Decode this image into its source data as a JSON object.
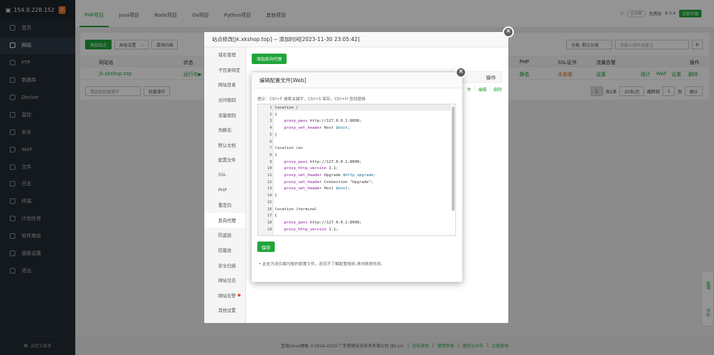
{
  "sidebar": {
    "host": "154.9.228.152",
    "badge": "0",
    "items": [
      {
        "label": "首页",
        "icon": "home-icon"
      },
      {
        "label": "网站",
        "icon": "globe-icon"
      },
      {
        "label": "FTP",
        "icon": "ftp-icon"
      },
      {
        "label": "数据库",
        "icon": "database-icon"
      },
      {
        "label": "Docker",
        "icon": "docker-icon"
      },
      {
        "label": "监控",
        "icon": "monitor-icon"
      },
      {
        "label": "安全",
        "icon": "shield-icon"
      },
      {
        "label": "WAF",
        "icon": "waf-icon"
      },
      {
        "label": "文件",
        "icon": "folder-icon"
      },
      {
        "label": "日志",
        "icon": "log-icon"
      },
      {
        "label": "终端",
        "icon": "terminal-icon"
      },
      {
        "label": "计划任务",
        "icon": "clock-icon"
      },
      {
        "label": "软件商店",
        "icon": "store-icon"
      },
      {
        "label": "面板设置",
        "icon": "gear-icon"
      },
      {
        "label": "退出",
        "icon": "logout-icon"
      }
    ],
    "bottom": "自定义菜单"
  },
  "topbar": {
    "tabs": [
      "PHP项目",
      "Java项目",
      "Node项目",
      "Go项目",
      "Python项目",
      "其他项目"
    ],
    "edition_pill": "企业版",
    "edition": "免费版",
    "version": "8.0.4",
    "upgrade": "立即升级"
  },
  "toolbar": {
    "add_site": "添加站点",
    "advanced": "高级设置",
    "scan": "漏洞扫描",
    "category": "分类: 默认分类",
    "search_placeholder": "请输入域名或备注"
  },
  "table": {
    "headers": [
      "网站名",
      "状态",
      "PHP",
      "SSL证书",
      "流量告警",
      "操作"
    ],
    "row": {
      "name": "jk.xkshop.top",
      "status": "运行中▶",
      "php": "静态",
      "ssl": "未部署",
      "alert": "设置",
      "actions": [
        "统计",
        "WAF",
        "设置",
        "删除"
      ]
    },
    "batch": "请选择批量操作",
    "batch_btn": "批量操作",
    "pagination": {
      "page": "1",
      "total": "共1条",
      "per_page": "20条/页",
      "goto": "跳转到",
      "goto_page": "1",
      "page_unit": "页",
      "confirm": "确认"
    }
  },
  "outer_modal": {
    "title": "站点修改[jk.xkshop.top] -- 添加时间[2023-11-30 23:05:42]",
    "nav": [
      "域名管理",
      "子目录绑定",
      "网站目录",
      "访问限制",
      "流量限制",
      "伪静态",
      "默认文档",
      "配置文件",
      "SSL",
      "PHP",
      "重定向",
      "反向代理",
      "防盗链",
      "防篡改",
      "安全扫描",
      "网站日志",
      "网站告警",
      "其他设置"
    ],
    "active_nav": "反向代理",
    "add_proxy": "添加反向代理",
    "col_action": "操作",
    "row_actions": [
      "件",
      "编辑",
      "删除"
    ]
  },
  "inner_modal": {
    "title": "编辑配置文件[Web]",
    "tip": "提示：Ctrl+F 搜索关键字，Ctrl+S 保存，Ctrl+H 查找替换",
    "lines": [
      "location /",
      "{",
      "    proxy_pass http://127.0.0.1:8008;",
      "    proxy_set_header Host $host;",
      "}",
      "",
      "location /ws",
      "{",
      "    proxy_pass http://127.0.0.1:8008;",
      "    proxy_http_version 1.1;",
      "    proxy_set_header Upgrade $http_upgrade;",
      "    proxy_set_header Connection \"Upgrade\";",
      "    proxy_set_header Host $host;",
      "}",
      "",
      "location /terminal",
      "{",
      "    proxy_pass http://127.0.0.1:8008;",
      "    proxy_http_version 1.1;"
    ],
    "save": "保存",
    "note": "此处为该负载均衡的配置文件，若您不了解配置规则,请勿随意修改。"
  },
  "help": {
    "service": "客服",
    "review": "评价"
  },
  "footer": {
    "copyright": "宝塔Linux面板 ©2014-2023 广东堡塔安全技术有限公司 (bt.cn)",
    "links": [
      "论坛求助",
      "使用手册",
      "微信公众号",
      "正版查询"
    ]
  }
}
